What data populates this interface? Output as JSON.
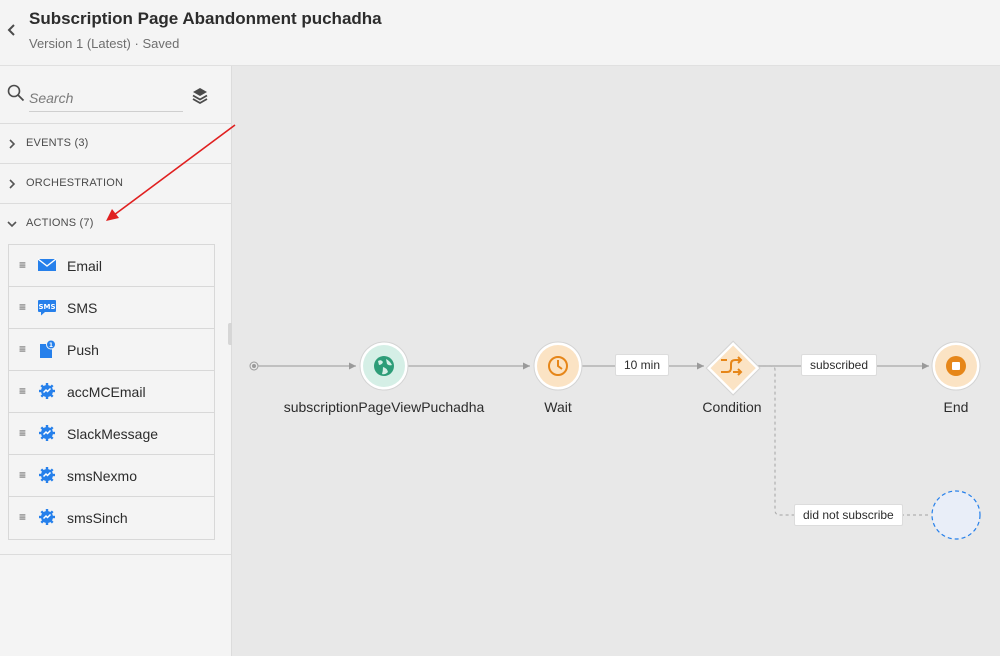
{
  "header": {
    "title": "Subscription Page Abandonment puchadha",
    "subtitle": "Version 1 (Latest) · Saved"
  },
  "sidebar": {
    "search": {
      "placeholder": "Search",
      "value": ""
    },
    "sections": [
      {
        "label": "EVENTS (3)",
        "expanded": false
      },
      {
        "label": "ORCHESTRATION",
        "expanded": false
      },
      {
        "label": "ACTIONS (7)",
        "expanded": true
      }
    ],
    "actions": [
      {
        "label": "Email",
        "icon": "email-icon"
      },
      {
        "label": "SMS",
        "icon": "sms-icon"
      },
      {
        "label": "Push",
        "icon": "push-icon"
      },
      {
        "label": "accMCEmail",
        "icon": "custom-action-icon"
      },
      {
        "label": "SlackMessage",
        "icon": "custom-action-icon"
      },
      {
        "label": "smsNexmo",
        "icon": "custom-action-icon"
      },
      {
        "label": "smsSinch",
        "icon": "custom-action-icon"
      }
    ]
  },
  "canvas": {
    "nodes": {
      "event": {
        "label": "subscriptionPageViewPuchadha",
        "icon": "globe-icon"
      },
      "wait": {
        "label": "Wait",
        "icon": "clock-icon"
      },
      "condition": {
        "label": "Condition",
        "icon": "branch-icon"
      },
      "end": {
        "label": "End",
        "icon": "stop-icon"
      }
    },
    "edges": {
      "wait_duration": "10 min",
      "path_subscribed": "subscribed",
      "path_not_subscribed": "did not subscribe"
    }
  },
  "colors": {
    "accent_blue": "#2680eb",
    "event_green": "#2d9d78",
    "wait_orange": "#e68619",
    "annotation_red": "#e02020"
  }
}
